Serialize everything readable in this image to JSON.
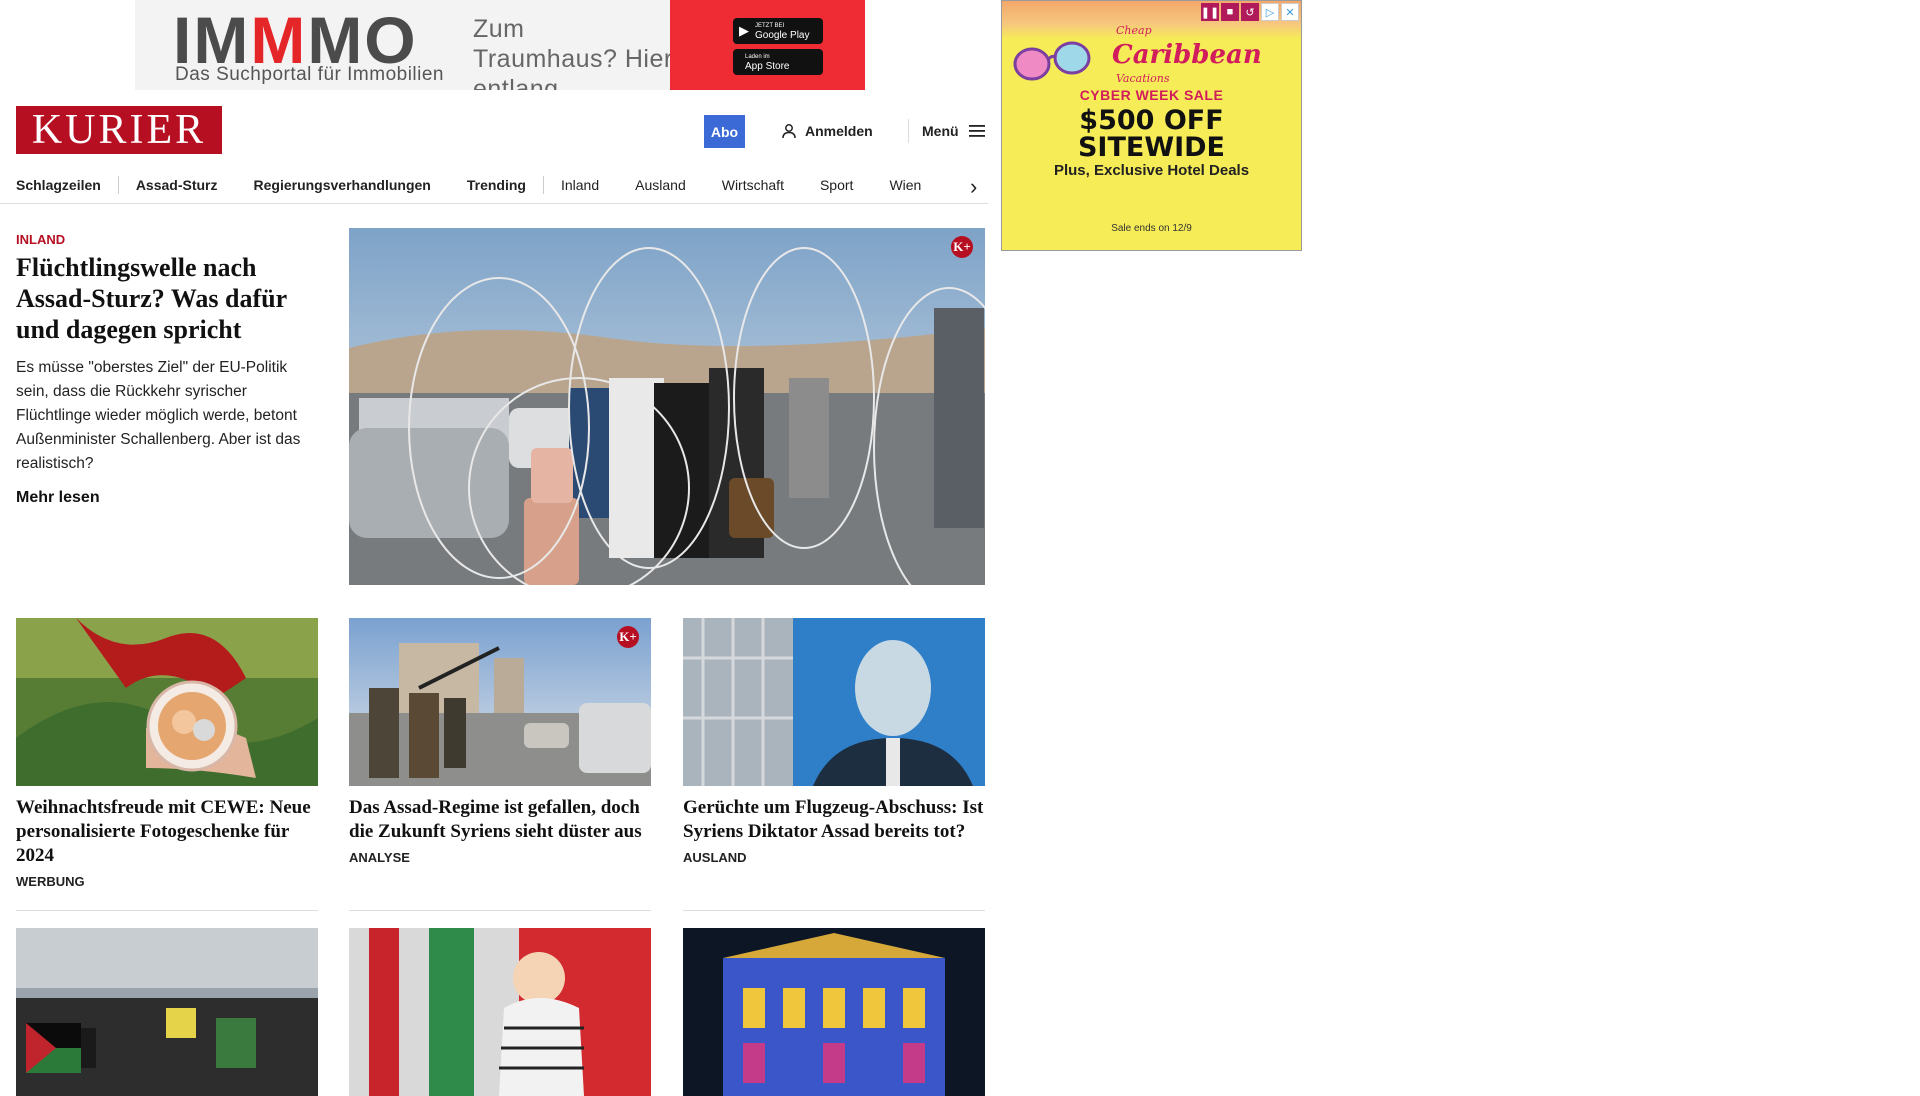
{
  "ads": {
    "top": {
      "brand_a": "IM",
      "brand_b": "M",
      "brand_c": "MO",
      "subtitle": "Das Suchportal für Immobilien",
      "claim": "Zum Traumhaus? Hier entlang.",
      "google_play_small": "JETZT BEI",
      "google_play": "Google Play",
      "app_store_small": "Laden im",
      "app_store": "App Store",
      "colors": {
        "red": "#ef2b33",
        "gray": "#4b4b4b"
      }
    },
    "side": {
      "logo_small": "Cheap",
      "logo": "Caribbean",
      "logo_sub": "Vacations",
      "sale": "CYBER WEEK SALE",
      "offer_line1": "$500 OFF",
      "offer_line2": "SITEWIDE",
      "deal": "Plus, Exclusive Hotel Deals",
      "ends": "Sale ends on 12/9",
      "colors": {
        "background": "#f6ec57",
        "accent": "#d21d5c"
      }
    }
  },
  "header": {
    "logo": "KURIER",
    "abo": "Abo",
    "login": "Anmelden",
    "menu": "Menü",
    "colors": {
      "brand": "#b70f22",
      "abo": "#3b6ad6"
    }
  },
  "nav": {
    "items": [
      {
        "label": "Schlagzeilen"
      },
      {
        "label": "Assad-Sturz"
      },
      {
        "label": "Regierungsverhandlungen"
      },
      {
        "label": "Trending"
      },
      {
        "label": "Inland"
      },
      {
        "label": "Ausland"
      },
      {
        "label": "Wirtschaft"
      },
      {
        "label": "Sport"
      },
      {
        "label": "Wien"
      }
    ]
  },
  "lead": {
    "category": "INLAND",
    "title": "Flüchtlingswelle nach Assad-Sturz? Was dafür und dagegen spricht",
    "teaser": "Es müsse \"oberstes Ziel\" der EU-Politik sein, dass die Rückkehr syrischer Flüchtlinge wieder möglich werde, betont Außenminister Schallenberg. Aber ist das realistisch?",
    "more": "Mehr lesen",
    "badge": "K+"
  },
  "cards": [
    {
      "title": "Weihnachtsfreude mit CEWE: Neue personalisierte Fotogeschenke für 2024",
      "category": "WERBUNG",
      "badge": ""
    },
    {
      "title": "Das Assad-Regime ist gefallen, doch die Zukunft Syriens sieht düster aus",
      "category": "ANALYSE",
      "badge": "K+"
    },
    {
      "title": "Gerüchte um Flugzeug-Abschuss: Ist Syriens Diktator Assad bereits tot?",
      "category": "AUSLAND",
      "badge": ""
    }
  ]
}
